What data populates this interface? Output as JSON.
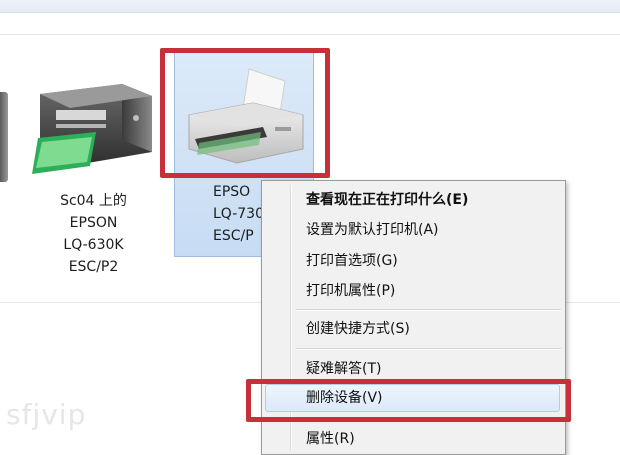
{
  "devices": [
    {
      "label_lines": [
        "Sc04 上的",
        "EPSON",
        "LQ-630K",
        "ESC/P2"
      ],
      "icon": "printer-icon"
    },
    {
      "label_lines": [
        "EPSO",
        "LQ-730",
        "ESC/P"
      ],
      "icon": "printer-icon",
      "selected": true
    }
  ],
  "context_menu": {
    "items": [
      {
        "label": "查看现在正在打印什么(E)",
        "bold": true
      },
      {
        "label": "设置为默认打印机(A)"
      },
      {
        "label": "打印首选项(G)"
      },
      {
        "label": "打印机属性(P)"
      },
      {
        "label": "创建快捷方式(S)"
      },
      {
        "label": "疑难解答(T)"
      },
      {
        "label": "删除设备(V)",
        "highlighted": true
      },
      {
        "label": "属性(R)"
      }
    ]
  },
  "watermark": "sfjvip",
  "colors": {
    "highlight_red": "#c7303a",
    "selection_blue": "#c7dcf3",
    "menu_bg": "#f1f1f1"
  }
}
